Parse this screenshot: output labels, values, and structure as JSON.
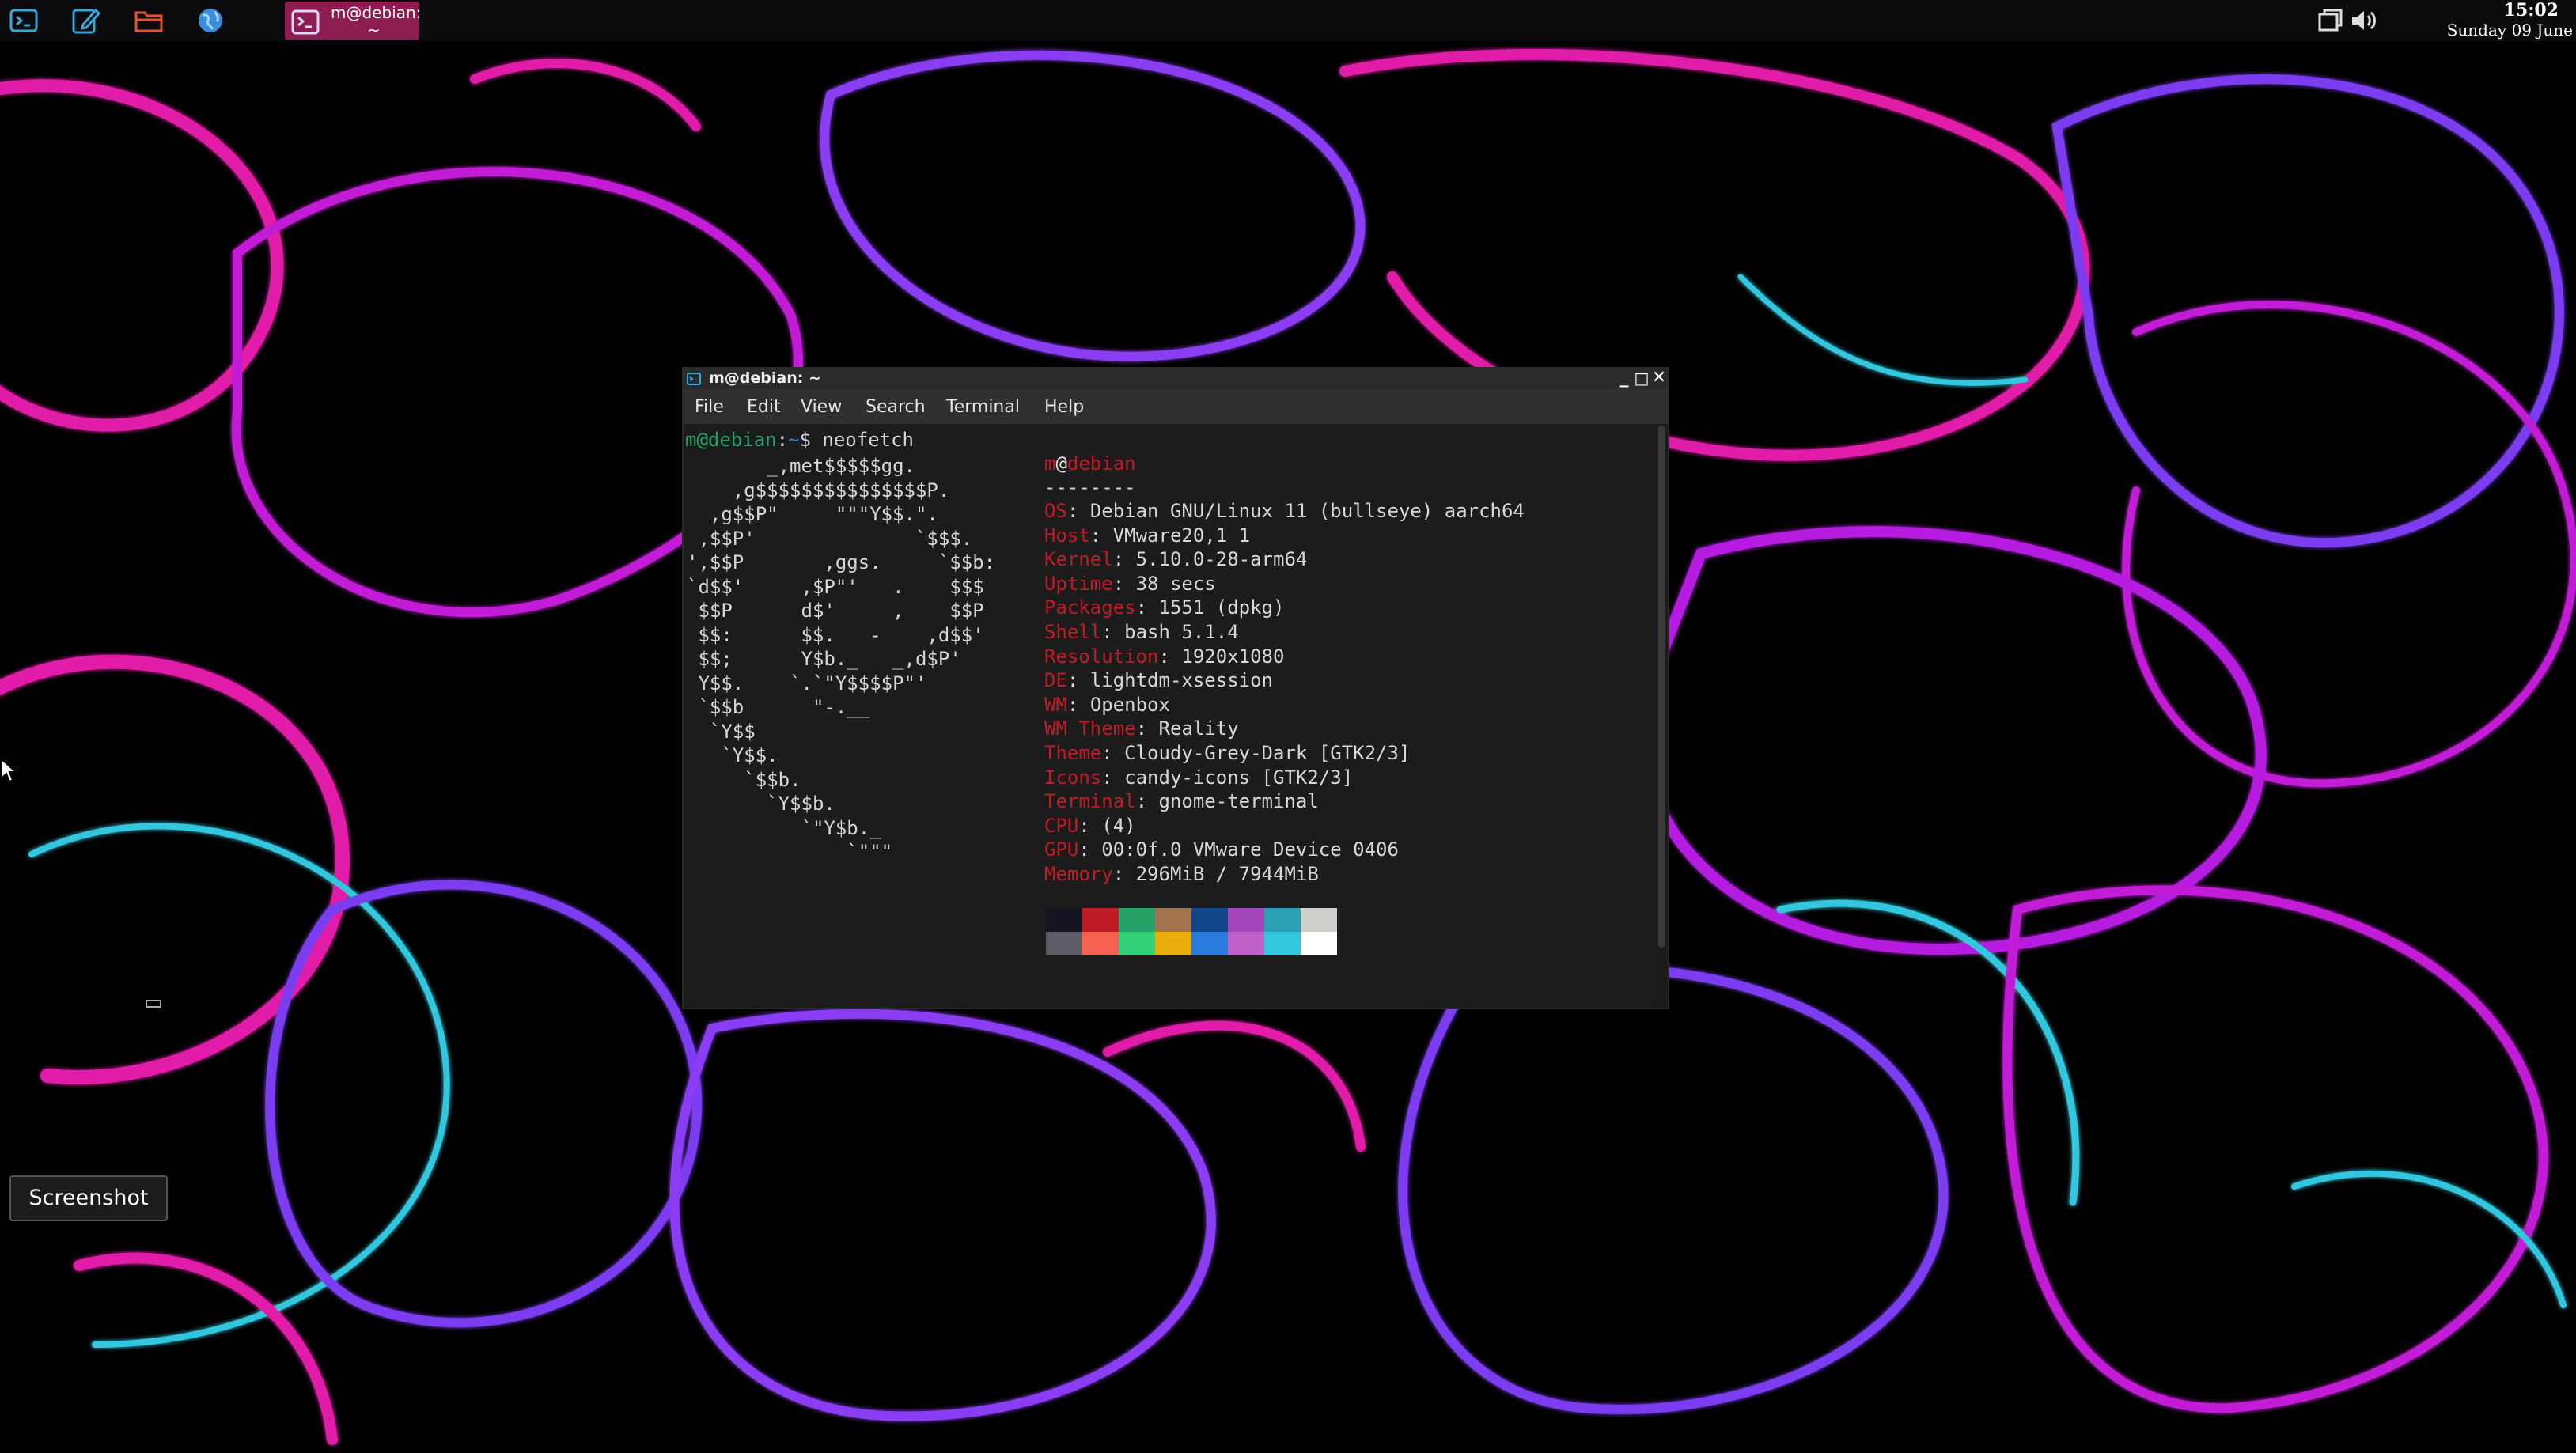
{
  "panel": {
    "launchers": [
      {
        "name": "terminal-launcher-icon"
      },
      {
        "name": "text-editor-launcher-icon"
      },
      {
        "name": "file-manager-launcher-icon"
      },
      {
        "name": "web-browser-launcher-icon"
      }
    ],
    "task": {
      "line1": "m@debian:",
      "line2": "~"
    },
    "clock": {
      "time": "15:02",
      "date": "Sunday 09 June"
    }
  },
  "window": {
    "title": "m@debian: ~",
    "controls": {
      "minimize": "_",
      "maximize": "□",
      "close": "✕"
    },
    "menus": [
      "File",
      "Edit",
      "View",
      "Search",
      "Terminal",
      "Help"
    ]
  },
  "terminal": {
    "prompt_user": "m@debian",
    "prompt_sep": ":",
    "prompt_path": "~",
    "prompt_symbol": "$",
    "command": "neofetch",
    "ascii_art": [
      "       _,met$$$$$gg.",
      "    ,g$$$$$$$$$$$$$$$P.",
      "  ,g$$P\"     \"\"\"Y$$.\".",
      " ,$$P'              `$$$.",
      "',$$P       ,ggs.     `$$b:",
      "`d$$'     ,$P\"'   .    $$$",
      " $$P      d$'     ,    $$P",
      " $$:      $$.   -    ,d$$'",
      " $$;      Y$b._   _,d$P'",
      " Y$$.    `.`\"Y$$$$P\"'",
      " `$$b      \"-.__",
      "  `Y$$",
      "   `Y$$.",
      "     `$$b.",
      "       `Y$$b.",
      "          `\"Y$b._",
      "              `\"\"\""
    ],
    "user": "m",
    "at": "@",
    "host": "debian",
    "separator": "--------",
    "info": [
      {
        "key": "OS",
        "value": "Debian GNU/Linux 11 (bullseye) aarch64"
      },
      {
        "key": "Host",
        "value": "VMware20,1 1"
      },
      {
        "key": "Kernel",
        "value": "5.10.0-28-arm64"
      },
      {
        "key": "Uptime",
        "value": "38 secs"
      },
      {
        "key": "Packages",
        "value": "1551 (dpkg)"
      },
      {
        "key": "Shell",
        "value": "bash 5.1.4"
      },
      {
        "key": "Resolution",
        "value": "1920x1080"
      },
      {
        "key": "DE",
        "value": "lightdm-xsession"
      },
      {
        "key": "WM",
        "value": "Openbox"
      },
      {
        "key": "WM Theme",
        "value": "Reality"
      },
      {
        "key": "Theme",
        "value": "Cloudy-Grey-Dark [GTK2/3]"
      },
      {
        "key": "Icons",
        "value": "candy-icons [GTK2/3]"
      },
      {
        "key": "Terminal",
        "value": "gnome-terminal"
      },
      {
        "key": "CPU",
        "value": "(4)"
      },
      {
        "key": "GPU",
        "value": "00:0f.0 VMware Device 0406"
      },
      {
        "key": "Memory",
        "value": "296MiB / 7944MiB"
      }
    ],
    "palette_top": [
      "#171421",
      "#c01c28",
      "#26a269",
      "#a2734c",
      "#12488b",
      "#a347ba",
      "#2aa1b3",
      "#d0cfcc"
    ],
    "palette_bottom": [
      "#5e5c64",
      "#f66151",
      "#33d17a",
      "#e9ad0c",
      "#2a7bde",
      "#c061cb",
      "#33c7de",
      "#ffffff"
    ]
  },
  "tooltip": {
    "label": "Screenshot"
  },
  "colors": {
    "panel_task_accent": "#8c1d4e",
    "wallpaper_magenta": "#e01ea8",
    "wallpaper_cyan": "#33c7de",
    "wallpaper_violet": "#7b3cf0"
  }
}
